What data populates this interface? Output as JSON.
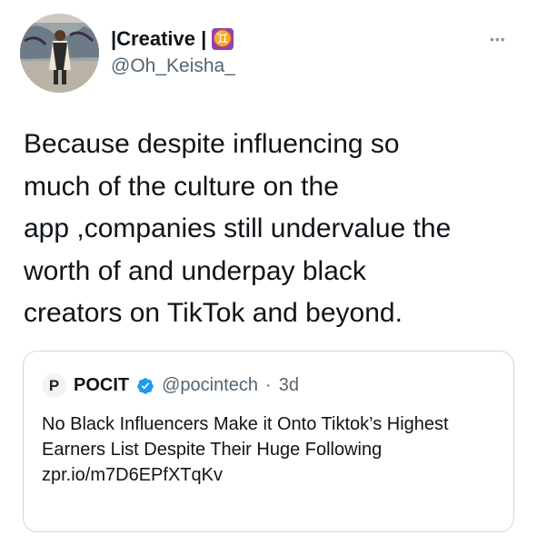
{
  "author": {
    "name": "|Creative |",
    "zodiac_glyph": "♊",
    "handle": "@Oh_Keisha_",
    "avatar": "profile-photo"
  },
  "more_glyph": "•••",
  "tweet": {
    "text": "Because despite influencing so\nmuch of the culture on the\napp ,companies still undervalue the\nworth of  and underpay black\ncreators on TikTok and beyond."
  },
  "quoted": {
    "avatar_letter": "P",
    "name": "POCIT",
    "handle": "@pocintech",
    "separator": "·",
    "time": "3d",
    "text": "No Black Influencers Make it Onto Tiktok’s Highest Earners List Despite Their Huge Following",
    "link": "zpr.io/m7D6EPfXTqKv"
  },
  "colors": {
    "verified": "#1d9bf0",
    "zodiac_bg": "#8e44ad",
    "secondary_text": "#536471",
    "border": "#cfd9de"
  }
}
